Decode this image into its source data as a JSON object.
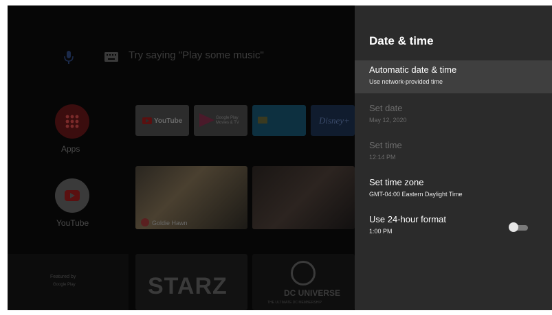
{
  "home": {
    "search_hint": "Try saying \"Play some music\"",
    "side_items": [
      {
        "label": "Apps"
      },
      {
        "label": "YouTube"
      }
    ],
    "tiles": {
      "youtube": "YouTube",
      "google_play": "Google Play Movies & TV",
      "disney": "Disney+",
      "video1_caption": "Goldie Hawn",
      "starz": "STARZ",
      "dc_title": "DC UNIVERSE",
      "dc_sub": "THE ULTIMATE DC MEMBERSHIP",
      "featured_label": "Featured by",
      "featured_brand": "Google Play"
    }
  },
  "panel": {
    "title": "Date & time",
    "items": [
      {
        "title": "Automatic date & time",
        "subtitle": "Use network-provided time",
        "state": "focused"
      },
      {
        "title": "Set date",
        "subtitle": "May 12, 2020",
        "state": "disabled"
      },
      {
        "title": "Set time",
        "subtitle": "12:14 PM",
        "state": "disabled"
      },
      {
        "title": "Set time zone",
        "subtitle": "GMT-04:00 Eastern Daylight Time",
        "state": "enabled"
      },
      {
        "title": "Use 24-hour format",
        "subtitle": "1:00 PM",
        "state": "enabled",
        "toggle": "off"
      }
    ]
  },
  "colors": {
    "panel_bg": "#2b2b2b",
    "focused_row": "#3f3f3f",
    "toggle_track": "#7a7a7a",
    "toggle_knob": "#e6e6e6"
  },
  "icons": [
    "microphone-icon",
    "keyboard-icon",
    "apps-grid-icon",
    "youtube-icon",
    "play-icon",
    "toggle-switch"
  ]
}
